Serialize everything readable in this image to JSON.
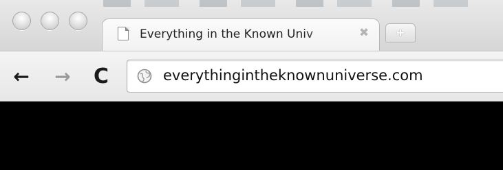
{
  "window": {
    "controls": [
      "close",
      "minimize",
      "zoom"
    ]
  },
  "tabs": [
    {
      "title": "Everything in the Known Univ",
      "favicon": "page-icon",
      "close_glyph": "✖"
    }
  ],
  "new_tab": {
    "glyph": "+"
  },
  "toolbar": {
    "back_glyph": "←",
    "forward_glyph": "→",
    "reload_glyph": "C",
    "omnibox": {
      "icon": "globe-icon",
      "url": "everythingintheknownuniverse.com"
    }
  },
  "colors": {
    "page_background": "#000000",
    "chrome_background": "#e6e6e6"
  }
}
